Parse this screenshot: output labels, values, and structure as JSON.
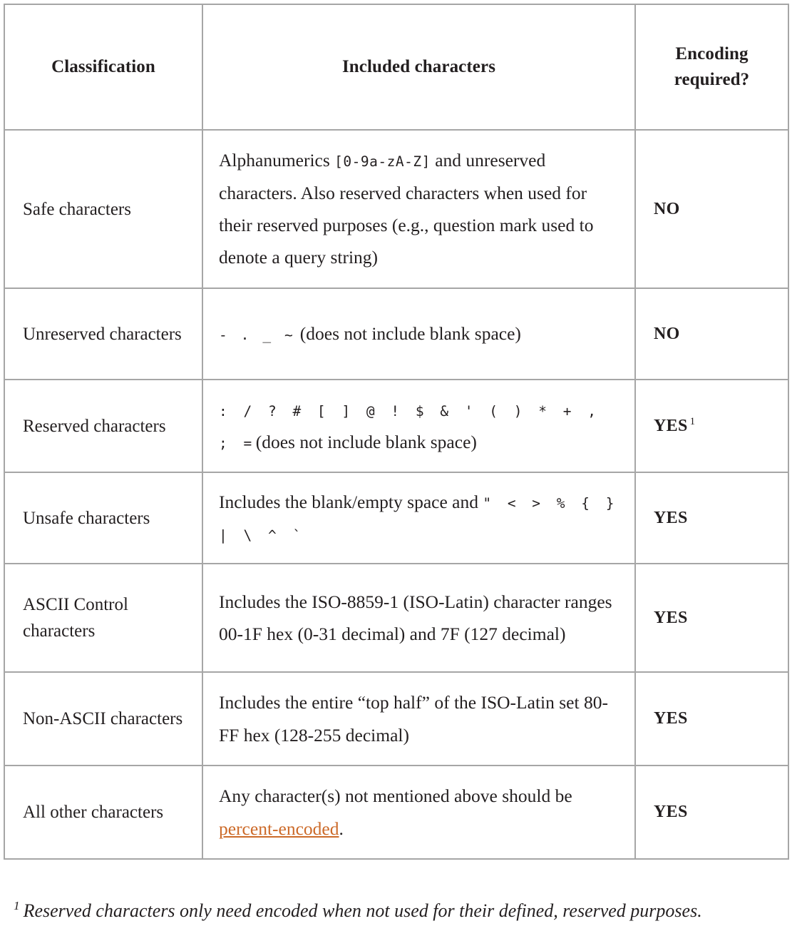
{
  "table": {
    "headers": [
      "Classification",
      "Included characters",
      "Encoding required?"
    ],
    "rows": [
      {
        "classification": "Safe characters",
        "chars_pre": "Alphanumerics ",
        "chars_mono": "[0-9a-zA-Z]",
        "chars_post": " and unreserved characters. Also reserved characters when used for their reserved purposes (e.g., question mark used to denote a query string)",
        "encoding": "NO",
        "footnote_marker": ""
      },
      {
        "classification": "Unreserved characters",
        "chars_pre": "",
        "chars_mono": "- . _ ~",
        "chars_post": " (does not include blank space)",
        "encoding": "NO",
        "footnote_marker": ""
      },
      {
        "classification": "Reserved characters",
        "chars_pre": "",
        "chars_mono": ": / ? # [ ] @ ! $ & ' ( ) * + , ; =",
        "chars_post": "(does not include blank space)",
        "encoding": "YES",
        "footnote_marker": "1"
      },
      {
        "classification": "Unsafe characters",
        "chars_pre": "Includes the blank/empty space and ",
        "chars_mono": "\" < > % { } | \\ ^ `",
        "chars_post": "",
        "encoding": "YES",
        "footnote_marker": ""
      },
      {
        "classification": "ASCII Control characters",
        "chars_pre": "Includes the ISO-8859-1 (ISO-Latin) character ranges 00-1F hex (0-31 decimal) and 7F (127 decimal)",
        "chars_mono": "",
        "chars_post": "",
        "encoding": "YES",
        "footnote_marker": ""
      },
      {
        "classification": "Non-ASCII characters",
        "chars_pre": "Includes the entire “top half” of the ISO-Latin set 80-FF hex (128-255 decimal)",
        "chars_mono": "",
        "chars_post": "",
        "encoding": "YES",
        "footnote_marker": ""
      },
      {
        "classification": "All other characters",
        "chars_pre": "Any character(s) not mentioned above should be ",
        "chars_link": "percent-encoded",
        "chars_post": ".",
        "chars_mono": "",
        "encoding": "YES",
        "footnote_marker": ""
      }
    ]
  },
  "footnote": {
    "marker": "1",
    "text": "Reserved characters only need encoded when not used for their defined, reserved purposes."
  },
  "colors": {
    "link": "#cc6a29",
    "border": "#a6a6a6",
    "text": "#231f20",
    "background": "#ffffff"
  }
}
